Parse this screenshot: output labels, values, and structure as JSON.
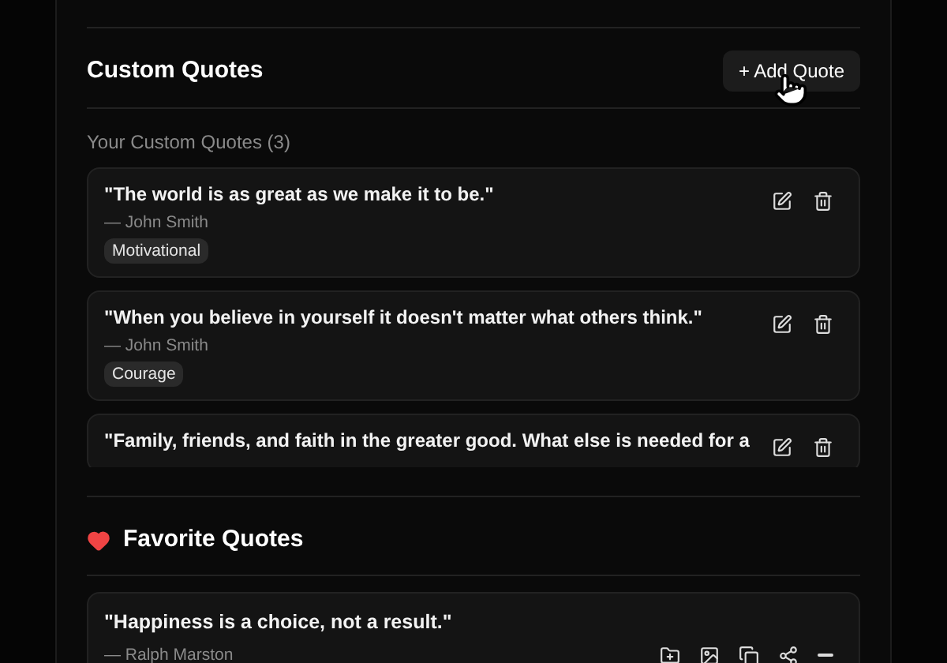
{
  "custom": {
    "title": "Custom Quotes",
    "add_button": "+ Add Quote",
    "subtitle": "Your Custom Quotes (3)",
    "quotes": [
      {
        "text": "\"The world is as great as we make it to be.\"",
        "author": "— John Smith",
        "tag": "Motivational"
      },
      {
        "text": "\"When you believe in yourself it doesn't matter what others think.\"",
        "author": "— John Smith",
        "tag": "Courage"
      },
      {
        "text": "\"Family, friends, and faith in the greater good. What else is needed for a"
      }
    ]
  },
  "favorites": {
    "title": "Favorite Quotes",
    "quotes": [
      {
        "text": "\"Happiness is a choice, not a result.\"",
        "author": "— Ralph Marston"
      }
    ]
  }
}
